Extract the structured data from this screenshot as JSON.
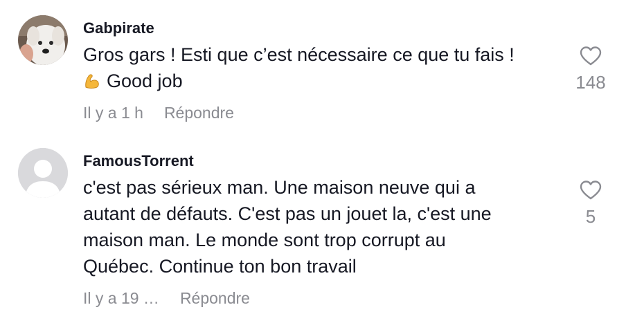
{
  "comments": [
    {
      "username": "Gabpirate",
      "text_line1": "Gros gars ! Esti que c’est nécessaire ce que tu fais !",
      "text_line2": "Good job",
      "emoji": "flexed-biceps-emoji",
      "time": "Il y a 1 h",
      "reply_label": "Répondre",
      "like_count": "148",
      "avatar": "dog-avatar"
    },
    {
      "username": "FamousTorrent",
      "text_lines": [
        "c'est pas sérieux man. Une maison neuve qui a",
        "autant de défauts. C'est pas un jouet la, c'est une",
        "maison man. Le monde sont trop corrupt au",
        "Québec. Continue ton bon travail"
      ],
      "time": "Il y a 19 …",
      "reply_label": "Répondre",
      "like_count": "5",
      "avatar": "default-user-avatar"
    }
  ],
  "colors": {
    "text": "#161823",
    "muted": "#8a8b91",
    "avatar_default_bg": "#d9d9dc",
    "avatar_default_fg": "#ffffff"
  },
  "icons": {
    "like": "heart-outline-icon"
  }
}
